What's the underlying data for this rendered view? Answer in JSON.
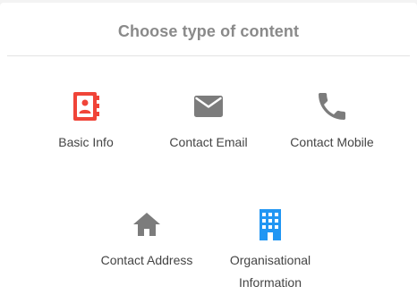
{
  "dialog": {
    "title": "Choose type of content"
  },
  "options": [
    {
      "label": "Basic Info",
      "icon": "contact-book-icon",
      "color": "#f04438"
    },
    {
      "label": "Contact Email",
      "icon": "envelope-icon",
      "color": "#7c7c7c"
    },
    {
      "label": "Contact Mobile",
      "icon": "phone-icon",
      "color": "#7c7c7c"
    },
    {
      "label": "Contact Address",
      "icon": "home-icon",
      "color": "#7c7c7c"
    },
    {
      "label_line1": "Organisational",
      "label_line2": "Information",
      "icon": "building-icon",
      "color": "#2196f3"
    }
  ]
}
